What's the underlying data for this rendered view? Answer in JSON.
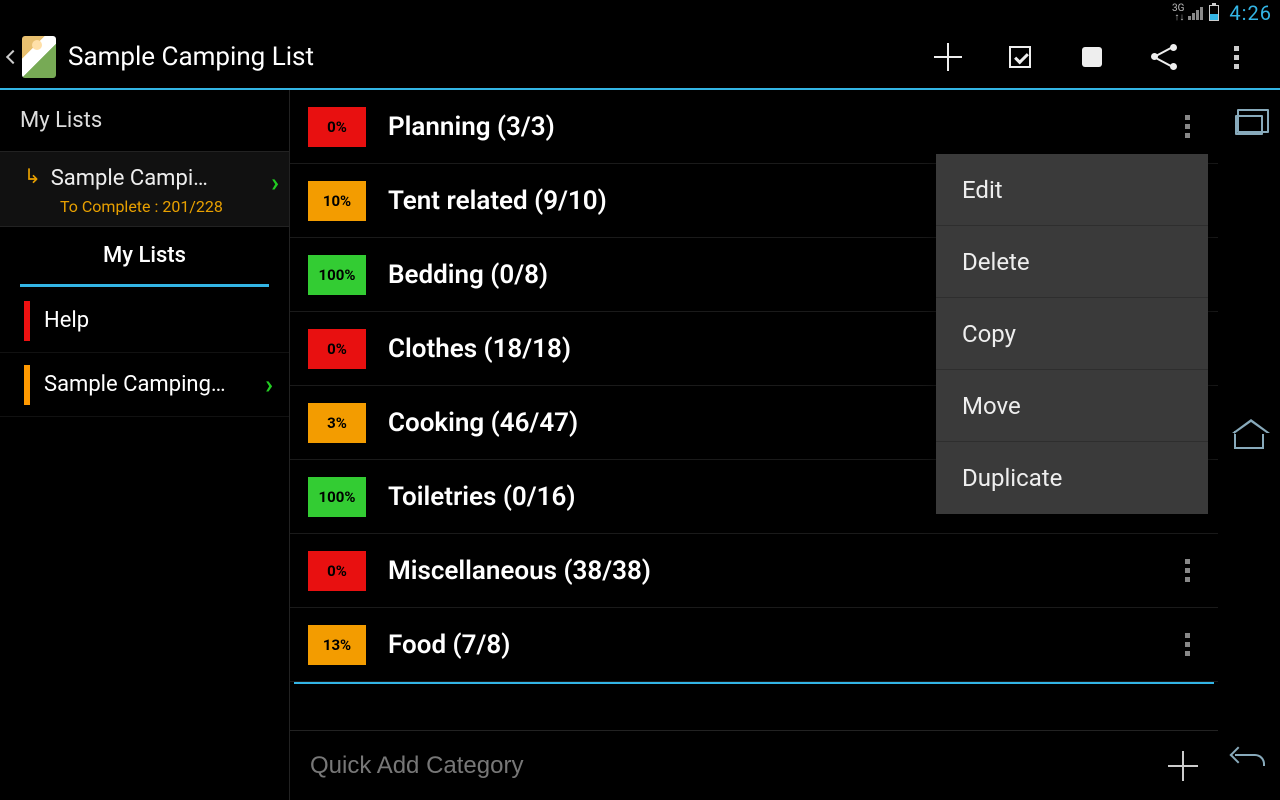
{
  "status": {
    "network": "3G",
    "clock": "4:26"
  },
  "actionbar": {
    "title": "Sample Camping List"
  },
  "sidebar": {
    "header": "My Lists",
    "current": {
      "name": "Sample Campi…",
      "subtitle": "To Complete : 201/228"
    },
    "tab_header": "My Lists",
    "rows": [
      {
        "label": "Help",
        "color": "red",
        "chevron": false
      },
      {
        "label": "Sample Camping…",
        "color": "org",
        "chevron": true
      }
    ]
  },
  "categories": [
    {
      "pct": "0%",
      "color": "red",
      "name": "Planning (3/3)"
    },
    {
      "pct": "10%",
      "color": "orange",
      "name": "Tent related (9/10)"
    },
    {
      "pct": "100%",
      "color": "green",
      "name": "Bedding (0/8)"
    },
    {
      "pct": "0%",
      "color": "red",
      "name": "Clothes (18/18)"
    },
    {
      "pct": "3%",
      "color": "orange",
      "name": "Cooking (46/47)"
    },
    {
      "pct": "100%",
      "color": "green",
      "name": "Toiletries (0/16)"
    },
    {
      "pct": "0%",
      "color": "red",
      "name": "Miscellaneous (38/38)"
    },
    {
      "pct": "13%",
      "color": "orange",
      "name": "Food (7/8)"
    }
  ],
  "quick_add": {
    "placeholder": "Quick Add Category"
  },
  "context_menu": [
    {
      "label": "Edit"
    },
    {
      "label": "Delete"
    },
    {
      "label": "Copy"
    },
    {
      "label": "Move"
    },
    {
      "label": "Duplicate"
    }
  ]
}
